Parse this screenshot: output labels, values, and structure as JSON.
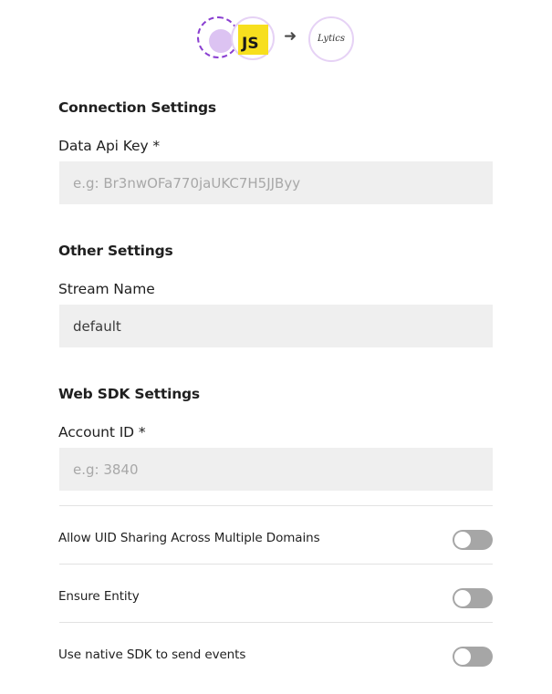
{
  "header": {
    "source_icon": "dashed-circle-source-icon",
    "js_icon_label": "JS",
    "arrow_icon": "arrow-right-icon",
    "destination_logo_text": "Lytics"
  },
  "connection_settings": {
    "heading": "Connection Settings",
    "data_api_key": {
      "label": "Data Api Key *",
      "placeholder": "e.g: Br3nwOFa770jaUKC7H5JJByy",
      "value": ""
    }
  },
  "other_settings": {
    "heading": "Other Settings",
    "stream_name": {
      "label": "Stream Name",
      "placeholder": "",
      "value": "default"
    }
  },
  "web_sdk_settings": {
    "heading": "Web SDK Settings",
    "account_id": {
      "label": "Account ID *",
      "placeholder": "e.g: 3840",
      "value": ""
    }
  },
  "toggles": [
    {
      "label": "Allow UID Sharing Across Multiple Domains",
      "enabled": false
    },
    {
      "label": "Ensure Entity",
      "enabled": false
    },
    {
      "label": "Use native SDK to send events",
      "enabled": false
    }
  ],
  "colors": {
    "accent_purple": "#8a3fd1",
    "js_yellow": "#f7df1e",
    "input_bg": "#efefef",
    "toggle_off": "#a6a6a6"
  }
}
